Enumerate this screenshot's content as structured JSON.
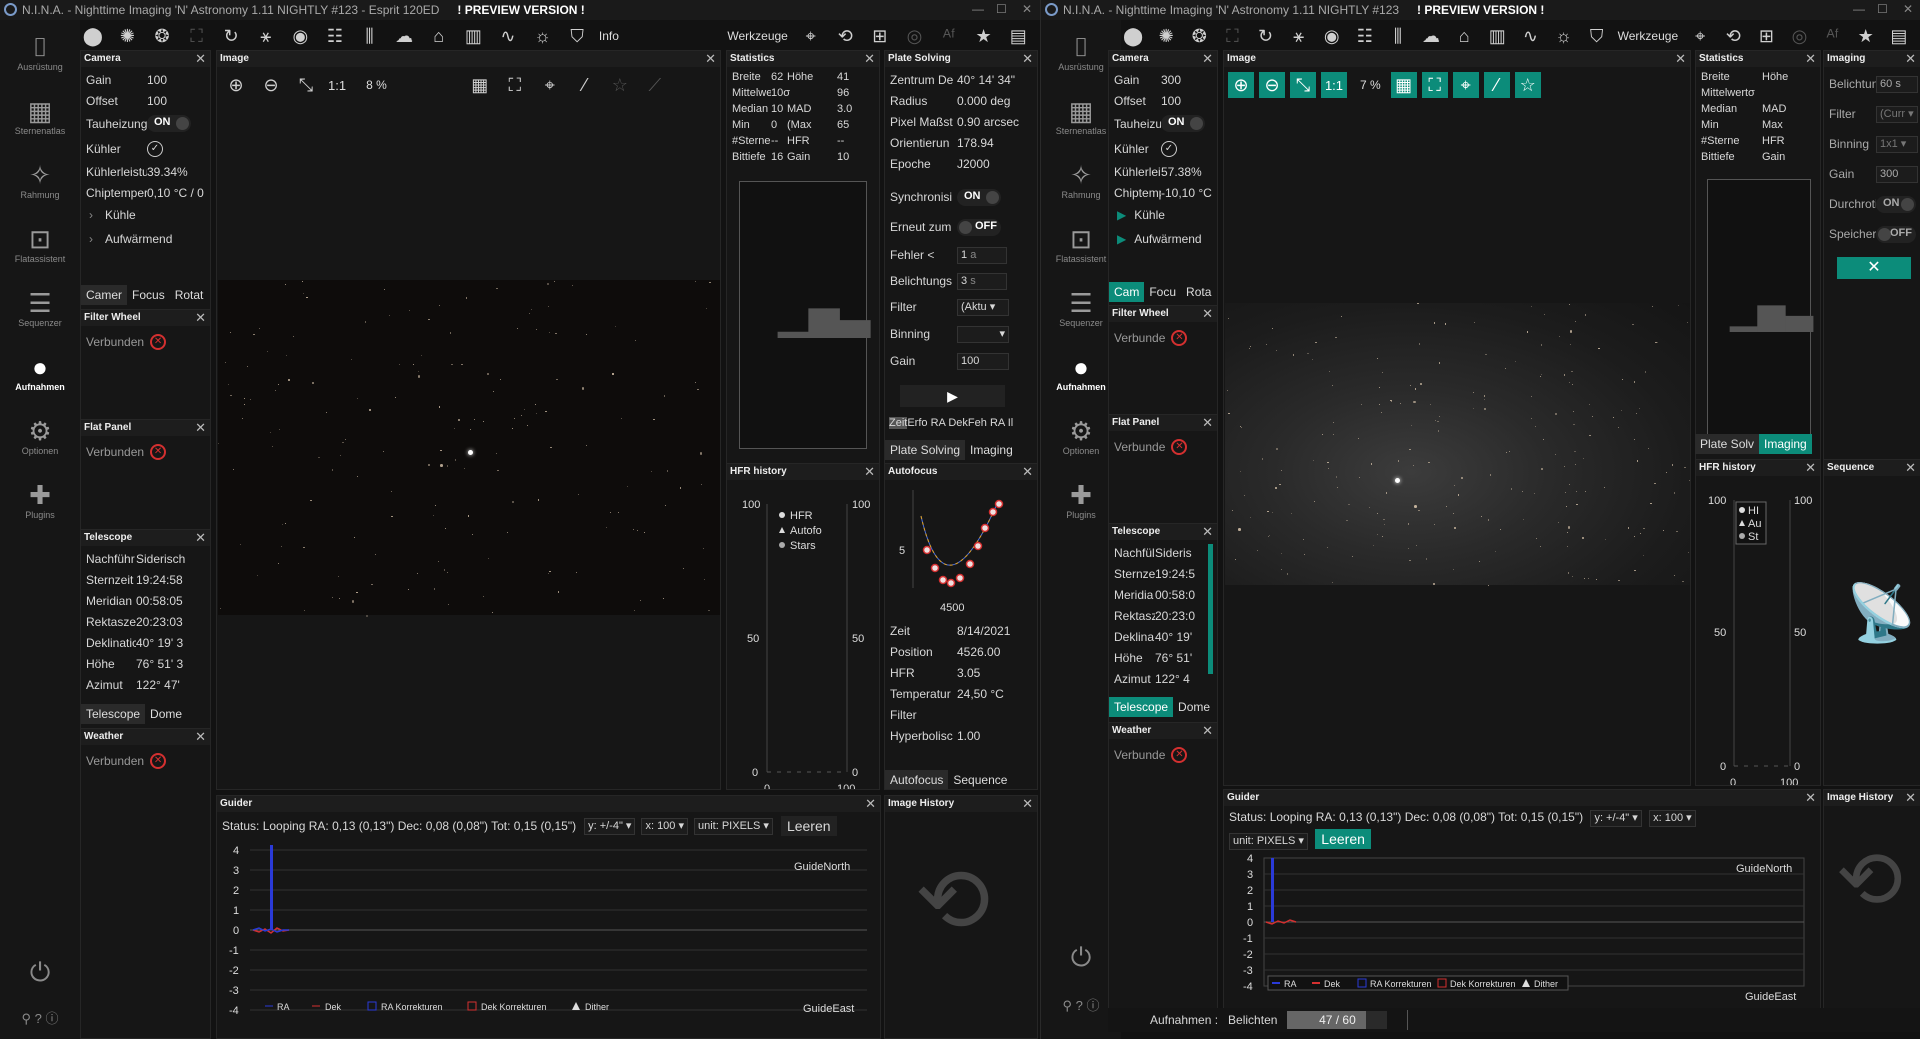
{
  "left": {
    "title": "N.I.N.A. - Nighttime Imaging 'N' Astronomy 1.11 NIGHTLY #123  -  Esprit 120ED",
    "preview": "! PREVIEW VERSION !",
    "toolbar": {
      "info": "Info",
      "werkzeuge": "Werkzeuge"
    },
    "sidebar": [
      "Ausrüstung",
      "Sternenatlas",
      "Rahmung",
      "Flatassistent",
      "Sequenzer",
      "Aufnahmen",
      "Optionen",
      "Plugins"
    ],
    "camera": {
      "title": "Camera",
      "rows": [
        [
          "Gain",
          "100"
        ],
        [
          "Offset",
          "100"
        ],
        [
          "Tauheizung",
          "ON"
        ],
        [
          "Kühler",
          ""
        ],
        [
          "Kühlerleistu",
          "39.34%"
        ],
        [
          "Chiptemper",
          "0,10 °C / 0"
        ]
      ],
      "cool": "Kühle",
      "warm": "Aufwärmend",
      "tabs": [
        "Camer",
        "Focus",
        "Rotat"
      ]
    },
    "filterwheel": {
      "title": "Filter Wheel",
      "status": "Verbunden"
    },
    "flatpanel": {
      "title": "Flat Panel",
      "status": "Verbunden"
    },
    "telescope": {
      "title": "Telescope",
      "rows": [
        [
          "Nachführ",
          "Siderisch"
        ],
        [
          "Sternzeit",
          "19:24:58"
        ],
        [
          "Meridian",
          "00:58:05"
        ],
        [
          "Rektaszer",
          "20:23:03"
        ],
        [
          "Deklinatic",
          "40° 19' 3"
        ],
        [
          "Höhe",
          "76° 51' 3"
        ],
        [
          "Azimut",
          "122° 47'"
        ]
      ],
      "tabs": [
        "Telescope",
        "Dome"
      ]
    },
    "weather": {
      "title": "Weather",
      "status": "Verbunden"
    },
    "image": {
      "title": "Image",
      "zoom": "8 %",
      "oneone": "1:1"
    },
    "statistics": {
      "title": "Statistics",
      "rows": [
        [
          "Breite",
          "62",
          "Höhe",
          "41"
        ],
        [
          "Mittelwert",
          "10σ",
          "",
          "96"
        ],
        [
          "Median",
          "10",
          "MAD",
          "3.0"
        ],
        [
          "Min",
          "0",
          "(Max",
          "65"
        ],
        [
          "#Sterne",
          "--",
          "HFR",
          "--"
        ],
        [
          "Bittiefe",
          "16",
          "Gain",
          "10"
        ]
      ]
    },
    "platesolving": {
      "title": "Plate Solving",
      "rows": [
        [
          "Zentrum De",
          "40° 14' 34\""
        ],
        [
          "Radius",
          "0.000 deg"
        ],
        [
          "Pixel Maßst",
          "0.90 arcsec"
        ],
        [
          "Orientierun",
          "178.94"
        ],
        [
          "Epoche",
          "J2000"
        ]
      ],
      "sync": "Synchronisi",
      "sync_val": "ON",
      "reslew": "Erneut zum",
      "reslew_val": "OFF",
      "err": "Fehler <",
      "err_val": "1",
      "err_unit": "a",
      "exp": "Belichtungs",
      "exp_val": "3",
      "exp_unit": "s",
      "filter": "Filter",
      "filter_val": "(Aktu",
      "binning": "Binning",
      "gain": "Gain",
      "gain_val": "100",
      "table_hdr": [
        "Zeit",
        "Erfo",
        "RA",
        "DekFeh",
        "RA",
        "Il"
      ],
      "tabs": [
        "Plate Solving",
        "Imaging"
      ]
    },
    "hfr": {
      "title": "HFR history",
      "y_left": [
        "100",
        "50",
        "0"
      ],
      "y_right": [
        "100",
        "50",
        "0"
      ],
      "x": [
        "0",
        "100"
      ],
      "legend": [
        "HFR",
        "Autofo",
        "Stars"
      ]
    },
    "autofocus": {
      "title": "Autofocus",
      "ylab": "5",
      "xlab": "4500",
      "rows": [
        [
          "Zeit",
          "8/14/2021"
        ],
        [
          "Position",
          "4526.00"
        ],
        [
          "HFR",
          "3.05"
        ],
        [
          "Temperatur",
          "24,50 °C"
        ],
        [
          "Filter",
          ""
        ],
        [
          "Hyperbolisc",
          "1.00"
        ]
      ],
      "tabs": [
        "Autofocus",
        "Sequence"
      ]
    },
    "guider": {
      "title": "Guider",
      "status": "Status: Looping  RA: 0,13 (0,13\")  Dec: 0,08 (0,08\")  Tot: 0,15 (0,15\")",
      "y": "y: +/-4\"",
      "x": "x: 100",
      "unit": "unit: PIXELS",
      "clear": "Leeren",
      "north": "GuideNorth",
      "east": "GuideEast",
      "yticks": [
        "4",
        "3",
        "2",
        "1",
        "0",
        "-1",
        "-2",
        "-3",
        "-4"
      ],
      "legend": [
        "RA",
        "Dek",
        "RA Korrekturen",
        "Dek Korrekturen",
        "Dither"
      ]
    },
    "history": {
      "title": "Image History"
    }
  },
  "right": {
    "title": "N.I.N.A. - Nighttime Imaging 'N' Astronomy 1.11 NIGHTLY #123",
    "preview": "! PREVIEW VERSION !",
    "toolbar": {
      "werkzeuge": "Werkzeuge"
    },
    "sidebar": [
      "Ausrüstung",
      "Sternenatlas",
      "Rahmung",
      "Flatassistent",
      "Sequenzer",
      "Aufnahmen",
      "Optionen",
      "Plugins"
    ],
    "camera": {
      "title": "Camera",
      "rows": [
        [
          "Gain",
          "300"
        ],
        [
          "Offset",
          "100"
        ],
        [
          "Tauheizur",
          "ON"
        ],
        [
          "Kühler",
          ""
        ],
        [
          "Kühlerleis",
          "57.38%"
        ],
        [
          "Chiptemp",
          "-10,10 °C"
        ]
      ],
      "cool": "Kühle",
      "warm": "Aufwärmend",
      "tabs": [
        "Cam",
        "Focu",
        "Rota"
      ]
    },
    "filterwheel": {
      "title": "Filter Wheel",
      "status": "Verbunde"
    },
    "flatpanel": {
      "title": "Flat Panel",
      "status": "Verbunde"
    },
    "telescope": {
      "title": "Telescope",
      "rows": [
        [
          "Nachfül",
          "Sideris"
        ],
        [
          "Sternze",
          "19:24:5"
        ],
        [
          "Meridia",
          "00:58:0"
        ],
        [
          "Rektasz",
          "20:23:0"
        ],
        [
          "Deklina",
          "40° 19'"
        ],
        [
          "Höhe",
          "76° 51'"
        ],
        [
          "Azimut",
          "122° 4"
        ]
      ],
      "tabs": [
        "Telescope",
        "Dome"
      ]
    },
    "weather": {
      "title": "Weather",
      "status": "Verbunde"
    },
    "image": {
      "title": "Image",
      "zoom": "7 %",
      "oneone": "1:1"
    },
    "statistics": {
      "title": "Statistics",
      "rows": [
        [
          "Breite",
          "Höhe"
        ],
        [
          "Mittelwertσ",
          ""
        ],
        [
          "Median",
          "MAD"
        ],
        [
          "Min",
          "Max"
        ],
        [
          "#Sterne",
          "HFR"
        ],
        [
          "Bittiefe",
          "Gain"
        ]
      ],
      "tabs": [
        "Plate Solv",
        "Imaging"
      ]
    },
    "imaging": {
      "title": "Imaging",
      "rows": [
        [
          "Belichtungs",
          "60",
          "s"
        ],
        [
          "Filter",
          "(Curr",
          ""
        ],
        [
          "Binning",
          "1x1",
          ""
        ],
        [
          "Gain",
          "300",
          ""
        ],
        [
          "Durchrotier",
          "ON",
          ""
        ],
        [
          "Speichern",
          "OFF",
          ""
        ]
      ]
    },
    "hfr": {
      "title": "HFR history",
      "y_left": [
        "100",
        "50",
        "0"
      ],
      "y_right": [
        "100",
        "50",
        "0"
      ],
      "x": [
        "0",
        "100"
      ],
      "legend": [
        "HI",
        "Au",
        "St"
      ]
    },
    "sequence": {
      "title": "Sequence"
    },
    "guider": {
      "title": "Guider",
      "status": "Status: Looping  RA: 0,13 (0,13\")  Dec: 0,08 (0,08\")  Tot: 0,15 (0,15\")",
      "y": "y: +/-4\"",
      "x": "x: 100",
      "unit": "unit: PIXELS",
      "clear": "Leeren",
      "north": "GuideNorth",
      "east": "GuideEast",
      "yticks": [
        "4",
        "3",
        "2",
        "1",
        "0",
        "-1",
        "-2",
        "-3",
        "-4"
      ],
      "legend": [
        "RA",
        "Dek",
        "RA Korrekturen",
        "Dek Korrekturen",
        "Dither"
      ]
    },
    "history": {
      "title": "Image History"
    },
    "statusbar": {
      "label": "Aufnahmen :",
      "exposure": "Belichten",
      "progress": "47 / 60",
      "progress_fraction": 0.783
    }
  }
}
